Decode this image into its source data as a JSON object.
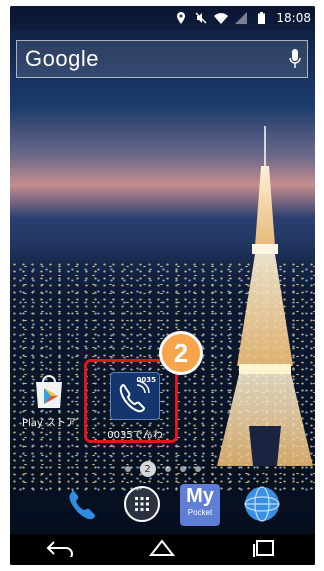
{
  "status": {
    "time": "18:08",
    "icons": [
      "location-icon",
      "mute-icon",
      "wifi-icon",
      "no-signal-icon",
      "battery-icon"
    ]
  },
  "search": {
    "logo": "Google",
    "icon": "mic-icon"
  },
  "apps": [
    {
      "label": "Play ストア",
      "icon": "play-store-icon"
    },
    {
      "label": "0035でんわ",
      "icon": "phone-icon",
      "tile_number": "0035"
    }
  ],
  "highlight": {
    "step_number": "2",
    "color": "#e0161a",
    "badge_color": "#f8a44c"
  },
  "pager": {
    "current_page": "2",
    "total_dots": 5
  },
  "dock": {
    "items": [
      "phone-icon",
      "app-drawer-icon",
      "mypocket-icon",
      "browser-icon"
    ],
    "mypocket_title": "My",
    "mypocket_sub": "Pocket"
  },
  "navbar": [
    "back-icon",
    "home-icon",
    "recents-icon"
  ]
}
